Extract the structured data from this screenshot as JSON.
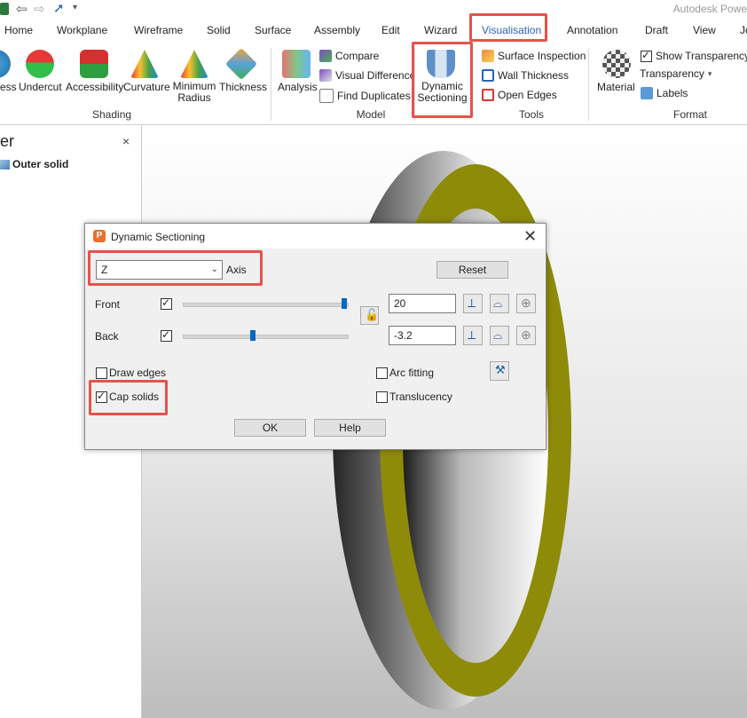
{
  "app": {
    "title": "Autodesk Powe"
  },
  "tabs": [
    "Home",
    "Workplane",
    "Wireframe",
    "Solid",
    "Surface",
    "Assembly",
    "Edit",
    "Wizard",
    "Visualisation",
    "Annotation",
    "Draft",
    "View",
    "Jo"
  ],
  "ribbon": {
    "shading": {
      "items": [
        "ess",
        "Undercut",
        "Accessibility",
        "Curvature",
        "Minimum\nRadius",
        "Thickness"
      ],
      "group_label": "Shading"
    },
    "model": {
      "analysis_label": "Analysis",
      "compare_label": "Compare",
      "visual_difference_label": "Visual Difference",
      "find_duplicates_label": "Find Duplicates",
      "group_label": "Model"
    },
    "tools": {
      "dynamic_sectioning_label": "Dynamic\nSectioning",
      "surface_inspection_label": "Surface Inspection",
      "wall_thickness_label": "Wall Thickness",
      "open_edges_label": "Open Edges",
      "group_label": "Tools"
    },
    "format": {
      "material_label": "Material",
      "show_transparency_label": "Show Transparency",
      "transparency_label": "Transparency",
      "labels_label": "Labels",
      "group_label": "Format"
    }
  },
  "panel": {
    "title": "er",
    "close": "×",
    "tree_item": "Outer solid"
  },
  "dialog": {
    "title": "Dynamic Sectioning",
    "close": "✕",
    "axis_value": "Z",
    "axis_label": "Axis",
    "reset_label": "Reset",
    "front_label": "Front",
    "front_checked": true,
    "front_value": "20",
    "back_label": "Back",
    "back_checked": true,
    "back_value": "-3.2",
    "draw_edges_label": "Draw edges",
    "draw_edges_checked": false,
    "cap_solids_label": "Cap solids",
    "cap_solids_checked": true,
    "arc_fitting_label": "Arc fitting",
    "arc_fitting_checked": false,
    "translucency_label": "Translucency",
    "translucency_checked": false,
    "ok_label": "OK",
    "help_label": "Help"
  },
  "colors": {
    "accent": "#2a63b5",
    "highlight": "#e4534b",
    "section_cap": "#8e8b08",
    "slider": "#0a66c2"
  }
}
